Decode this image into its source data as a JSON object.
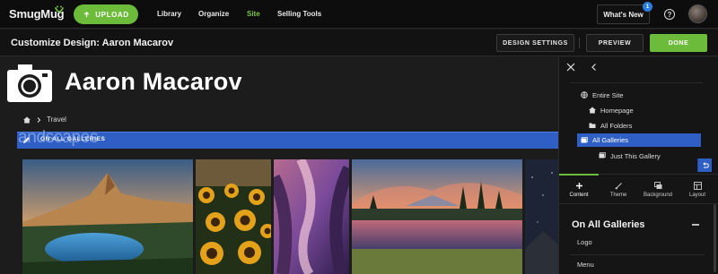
{
  "topnav": {
    "brand": "SmugMug",
    "upload_label": "UPLOAD",
    "links": [
      "Library",
      "Organize",
      "Site",
      "Selling Tools"
    ],
    "active_link": "Site",
    "whats_new_label": "What's New",
    "notification_count": "1",
    "help_icon": "question-circle-icon",
    "accent_color": "#6dbb3a"
  },
  "custbar": {
    "title": "Customize Design: Aaron Macarov",
    "design_settings_label": "DESIGN SETTINGS",
    "preview_label": "PREVIEW",
    "done_label": "DONE"
  },
  "preview": {
    "site_title": "Aaron Macarov",
    "breadcrumb": "Travel",
    "gallery_strip_label": "ON ALL GALLERIES",
    "gallery_ghost_text": "andscapes",
    "highlight_color": "#2f5fc4"
  },
  "panel": {
    "tree": [
      "Entire Site",
      "Homepage",
      "All Folders",
      "All Galleries",
      "Just This Gallery"
    ],
    "selected": "All Galleries",
    "tabs": [
      "Content",
      "Theme",
      "Background",
      "Layout"
    ],
    "active_tab": "Content",
    "section_title": "On All Galleries",
    "options": [
      "Logo",
      "Menu"
    ]
  }
}
